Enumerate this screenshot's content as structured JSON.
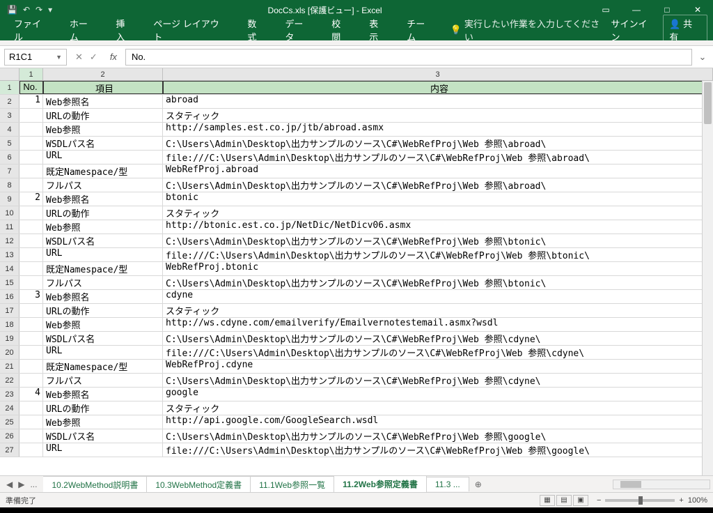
{
  "titlebar": {
    "title": "DocCs.xls  [保護ビュー] - Excel"
  },
  "ribbon": {
    "file": "ファイル",
    "home": "ホーム",
    "insert": "挿入",
    "pagelayout": "ページ レイアウト",
    "formulas": "数式",
    "data": "データ",
    "review": "校閲",
    "view": "表示",
    "team": "チーム",
    "tellme": "実行したい作業を入力してください",
    "signin": "サインイン",
    "share": "共有"
  },
  "formula": {
    "namebox": "R1C1",
    "content": "No."
  },
  "col_headers": {
    "c1": "1",
    "c2": "2",
    "c3": "3"
  },
  "header_row": {
    "c1": "No.",
    "c2": "項目",
    "c3": "内容"
  },
  "rows": [
    {
      "n": "2",
      "no": "1",
      "item": "Web参照名",
      "val": "abroad"
    },
    {
      "n": "3",
      "no": "",
      "item": "URLの動作",
      "val": "スタティック"
    },
    {
      "n": "4",
      "no": "",
      "item": "Web参照",
      "val": "http://samples.est.co.jp/jtb/abroad.asmx"
    },
    {
      "n": "5",
      "no": "",
      "item": "WSDLパス名",
      "val": "C:\\Users\\Admin\\Desktop\\出力サンプルのソース\\C#\\WebRefProj\\Web 参照\\abroad\\"
    },
    {
      "n": "6",
      "no": "",
      "item": "URL",
      "val": "file:///C:\\Users\\Admin\\Desktop\\出力サンプルのソース\\C#\\WebRefProj\\Web 参照\\abroad\\"
    },
    {
      "n": "7",
      "no": "",
      "item": "既定Namespace/型",
      "val": "WebRefProj.abroad"
    },
    {
      "n": "8",
      "no": "",
      "item": "フルパス",
      "val": "C:\\Users\\Admin\\Desktop\\出力サンプルのソース\\C#\\WebRefProj\\Web 参照\\abroad\\"
    },
    {
      "n": "9",
      "no": "2",
      "item": "Web参照名",
      "val": "btonic"
    },
    {
      "n": "10",
      "no": "",
      "item": "URLの動作",
      "val": "スタティック"
    },
    {
      "n": "11",
      "no": "",
      "item": "Web参照",
      "val": "http://btonic.est.co.jp/NetDic/NetDicv06.asmx"
    },
    {
      "n": "12",
      "no": "",
      "item": "WSDLパス名",
      "val": "C:\\Users\\Admin\\Desktop\\出力サンプルのソース\\C#\\WebRefProj\\Web 参照\\btonic\\"
    },
    {
      "n": "13",
      "no": "",
      "item": "URL",
      "val": "file:///C:\\Users\\Admin\\Desktop\\出力サンプルのソース\\C#\\WebRefProj\\Web 参照\\btonic\\"
    },
    {
      "n": "14",
      "no": "",
      "item": "既定Namespace/型",
      "val": "WebRefProj.btonic"
    },
    {
      "n": "15",
      "no": "",
      "item": "フルパス",
      "val": "C:\\Users\\Admin\\Desktop\\出力サンプルのソース\\C#\\WebRefProj\\Web 参照\\btonic\\"
    },
    {
      "n": "16",
      "no": "3",
      "item": "Web参照名",
      "val": "cdyne"
    },
    {
      "n": "17",
      "no": "",
      "item": "URLの動作",
      "val": "スタティック"
    },
    {
      "n": "18",
      "no": "",
      "item": "Web参照",
      "val": "http://ws.cdyne.com/emailverify/Emailvernotestemail.asmx?wsdl"
    },
    {
      "n": "19",
      "no": "",
      "item": "WSDLパス名",
      "val": "C:\\Users\\Admin\\Desktop\\出力サンプルのソース\\C#\\WebRefProj\\Web 参照\\cdyne\\"
    },
    {
      "n": "20",
      "no": "",
      "item": "URL",
      "val": "file:///C:\\Users\\Admin\\Desktop\\出力サンプルのソース\\C#\\WebRefProj\\Web 参照\\cdyne\\"
    },
    {
      "n": "21",
      "no": "",
      "item": "既定Namespace/型",
      "val": "WebRefProj.cdyne"
    },
    {
      "n": "22",
      "no": "",
      "item": "フルパス",
      "val": "C:\\Users\\Admin\\Desktop\\出力サンプルのソース\\C#\\WebRefProj\\Web 参照\\cdyne\\"
    },
    {
      "n": "23",
      "no": "4",
      "item": "Web参照名",
      "val": "google"
    },
    {
      "n": "24",
      "no": "",
      "item": "URLの動作",
      "val": "スタティック"
    },
    {
      "n": "25",
      "no": "",
      "item": "Web参照",
      "val": "http://api.google.com/GoogleSearch.wsdl"
    },
    {
      "n": "26",
      "no": "",
      "item": "WSDLパス名",
      "val": "C:\\Users\\Admin\\Desktop\\出力サンプルのソース\\C#\\WebRefProj\\Web 参照\\google\\"
    },
    {
      "n": "27",
      "no": "",
      "item": "URL",
      "val": "file:///C:\\Users\\Admin\\Desktop\\出力サンプルのソース\\C#\\WebRefProj\\Web 参照\\google\\"
    }
  ],
  "sheets": {
    "ellipsis": "...",
    "t1": "10.2WebMethod説明書",
    "t2": "10.3WebMethod定義書",
    "t3": "11.1Web参照一覧",
    "t4": "11.2Web参照定義書",
    "t5": "11.3  ..."
  },
  "status": {
    "ready": "準備完了",
    "zoom": "100%"
  }
}
